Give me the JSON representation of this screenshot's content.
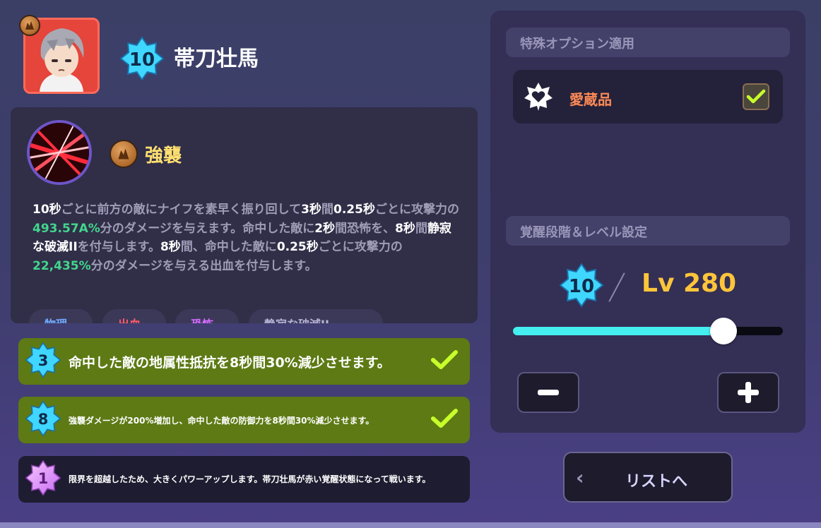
{
  "header": {
    "grade": "10",
    "name": "帯刀壮馬"
  },
  "skill": {
    "name": "強襲",
    "description_runs": [
      {
        "t": "10秒",
        "c": "w"
      },
      {
        "t": "ごとに前方の敵にナイフを素早く振り回して",
        "c": "n"
      },
      {
        "t": "3秒",
        "c": "w"
      },
      {
        "t": "間",
        "c": "n"
      },
      {
        "t": "0.25秒",
        "c": "w"
      },
      {
        "t": "ごとに攻撃力の",
        "c": "n"
      },
      {
        "t": "493.57A%",
        "c": "g"
      },
      {
        "t": "分のダメージを与えます。命中した敵に",
        "c": "n"
      },
      {
        "t": "2秒",
        "c": "w"
      },
      {
        "t": "間恐怖を、",
        "c": "n"
      },
      {
        "t": "8秒",
        "c": "w"
      },
      {
        "t": "間",
        "c": "n"
      },
      {
        "t": "静寂な破滅II",
        "c": "w"
      },
      {
        "t": "を付与します。",
        "c": "n"
      },
      {
        "t": "8秒",
        "c": "w"
      },
      {
        "t": "間、命中した敵に",
        "c": "n"
      },
      {
        "t": "0.25秒",
        "c": "w"
      },
      {
        "t": "ごとに攻撃力の",
        "c": "n"
      },
      {
        "t": "22,435%",
        "c": "g"
      },
      {
        "t": "分のダメージを与える出血を付与します。",
        "c": "n"
      }
    ],
    "tags": [
      {
        "label": "物理",
        "color": "#6fa8ff"
      },
      {
        "label": "出血",
        "color": "#ff5a6a"
      },
      {
        "label": "恐怖",
        "color": "#d46bff"
      },
      {
        "label": "静寂な破滅II",
        "color": "#b8b4d8"
      }
    ]
  },
  "passives": [
    {
      "level": "3",
      "text": "命中した敵の地属性抵抗を8秒間30%減少させます。",
      "active": true
    },
    {
      "level": "8",
      "text": "強襲ダメージが200%増加し、命中した敵の防御力を8秒間30%減少させます。",
      "active": true
    },
    {
      "level": "1",
      "text": "限界を超越したため、大きくパワーアップします。帯刀壮馬が赤い覚醒状態になって戦います。",
      "active": false
    }
  ],
  "special_option": {
    "title": "特殊オプション適用",
    "item_label": "愛蔵品",
    "checked": true
  },
  "awakening": {
    "title": "覚醒段階＆レベル設定",
    "grade": "10",
    "level_text": "Lv 280",
    "level_fraction": 0.78
  },
  "back_button": {
    "label": "リストへ",
    "chevron": "‹"
  },
  "colors": {
    "accent_cyan": "#45eef0",
    "level_gold": "#ffc53a",
    "skill_name": "#ffe070",
    "treasure": "#ff8a56",
    "passive_active_bg": "#5d7a14",
    "check": "#c8ff2a"
  }
}
